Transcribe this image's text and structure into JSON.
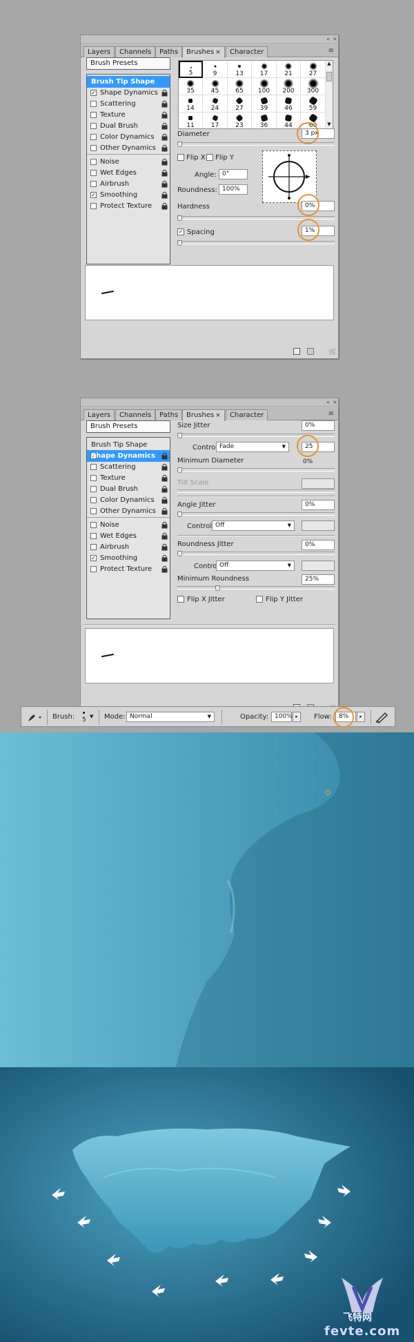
{
  "panel_tabs": [
    {
      "label": "Layers"
    },
    {
      "label": "Channels"
    },
    {
      "label": "Paths"
    },
    {
      "label": "Brushes",
      "close": "×"
    },
    {
      "label": "Character"
    }
  ],
  "panel_controls": {
    "collapse": "«",
    "close": "×",
    "menu": "≡"
  },
  "brush_presets_label": "Brush Presets",
  "brush_tip_shape_label": "Brush Tip Shape",
  "options": [
    {
      "label": "Shape Dynamics",
      "checked": true
    },
    {
      "label": "Scattering",
      "checked": false
    },
    {
      "label": "Texture",
      "checked": false
    },
    {
      "label": "Dual Brush",
      "checked": false
    },
    {
      "label": "Color Dynamics",
      "checked": false
    },
    {
      "label": "Other Dynamics",
      "checked": false
    },
    {
      "label": "Noise",
      "checked": false
    },
    {
      "label": "Wet Edges",
      "checked": false
    },
    {
      "label": "Airbrush",
      "checked": false
    },
    {
      "label": "Smoothing",
      "checked": true
    },
    {
      "label": "Protect Texture",
      "checked": false
    }
  ],
  "brush_sizes": [
    [
      "5",
      "9",
      "13",
      "17",
      "21",
      "27"
    ],
    [
      "35",
      "45",
      "65",
      "100",
      "200",
      "300"
    ],
    [
      "14",
      "24",
      "27",
      "39",
      "46",
      "59"
    ],
    [
      "11",
      "17",
      "23",
      "36",
      "44",
      "60"
    ]
  ],
  "tip_shape": {
    "diameter_label": "Diameter",
    "diameter_value": "3 px",
    "diameter_level": 0.0,
    "flip_x_label": "Flip X",
    "flip_y_label": "Flip Y",
    "angle_label": "Angle:",
    "angle_value": "0°",
    "roundness_label": "Roundness:",
    "roundness_value": "100%",
    "hardness_label": "Hardness",
    "hardness_value": "0%",
    "hardness_level": 0.0,
    "spacing_label": "Spacing",
    "spacing_checked": true,
    "spacing_value": "1%",
    "spacing_level": 0.0
  },
  "shape_dynamics": {
    "size_jitter_label": "Size Jitter",
    "size_jitter_value": "0%",
    "control_label": "Control:",
    "control_value": "Fade",
    "fade_steps": "25",
    "min_diameter_label": "Minimum Diameter",
    "min_diameter_value": "0%",
    "tilt_scale_label": "Tilt Scale",
    "angle_jitter_label": "Angle Jitter",
    "angle_jitter_value": "0%",
    "angle_control_label": "Control:",
    "angle_control_value": "Off",
    "roundness_jitter_label": "Roundness Jitter",
    "roundness_jitter_value": "0%",
    "roundness_control_label": "Control:",
    "roundness_control_value": "Off",
    "min_roundness_label": "Minimum Roundness",
    "min_roundness_value": "25%",
    "min_roundness_level": 0.25,
    "flip_x_jitter_label": "Flip X Jitter",
    "flip_y_jitter_label": "Flip Y Jitter"
  },
  "toolbar": {
    "brush_label": "Brush:",
    "brush_size": "5",
    "mode_label": "Mode:",
    "mode_value": "Normal",
    "opacity_label": "Opacity:",
    "opacity_value": "100%",
    "flow_label": "Flow:",
    "flow_value": "8%"
  },
  "watermark": {
    "site_cn": "飞特网",
    "site_en": "fevte.com"
  },
  "colors": {
    "highlight_circle": "#e8932c",
    "selection_blue": "#3399ff",
    "water_light": "#5fb4cf",
    "water_dark": "#1f6d8f"
  }
}
